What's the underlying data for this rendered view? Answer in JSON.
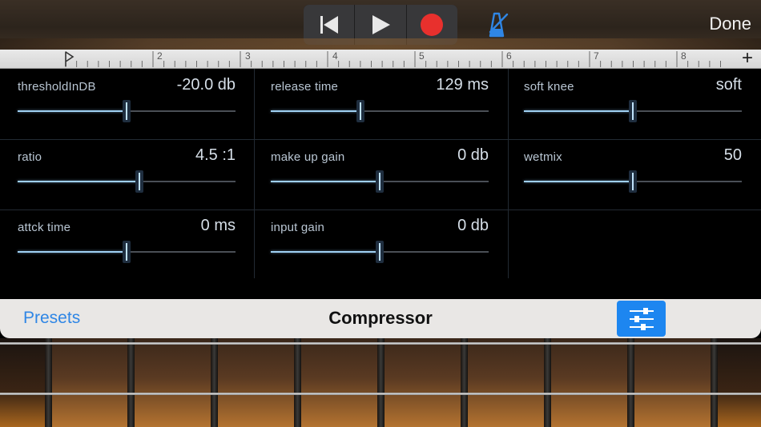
{
  "toolbar": {
    "done_label": "Done",
    "icons": [
      "skip-back-icon",
      "play-icon",
      "record-icon",
      "metronome-icon"
    ],
    "record_color": "#e8302d",
    "metronome_color": "#2f86e5"
  },
  "ruler": {
    "bars": [
      "2",
      "3",
      "4",
      "5",
      "6",
      "7",
      "8"
    ],
    "add_label": "+"
  },
  "params": [
    {
      "label": "thresholdInDB",
      "value": "-20.0 db",
      "level": 0.5
    },
    {
      "label": "release time",
      "value": "129 ms",
      "level": 0.41
    },
    {
      "label": "soft knee",
      "value": "soft",
      "level": 0.5
    },
    {
      "label": "ratio",
      "value": "4.5 :1",
      "level": 0.56
    },
    {
      "label": "make up gain",
      "value": "0 db",
      "level": 0.5
    },
    {
      "label": "wetmix",
      "value": "50",
      "level": 0.5
    },
    {
      "label": "attck time",
      "value": "0 ms",
      "level": 0.5
    },
    {
      "label": "input gain",
      "value": "0 db",
      "level": 0.5
    }
  ],
  "plugin_bar": {
    "presets_label": "Presets",
    "title": "Compressor",
    "accent": "#1d86f0"
  }
}
